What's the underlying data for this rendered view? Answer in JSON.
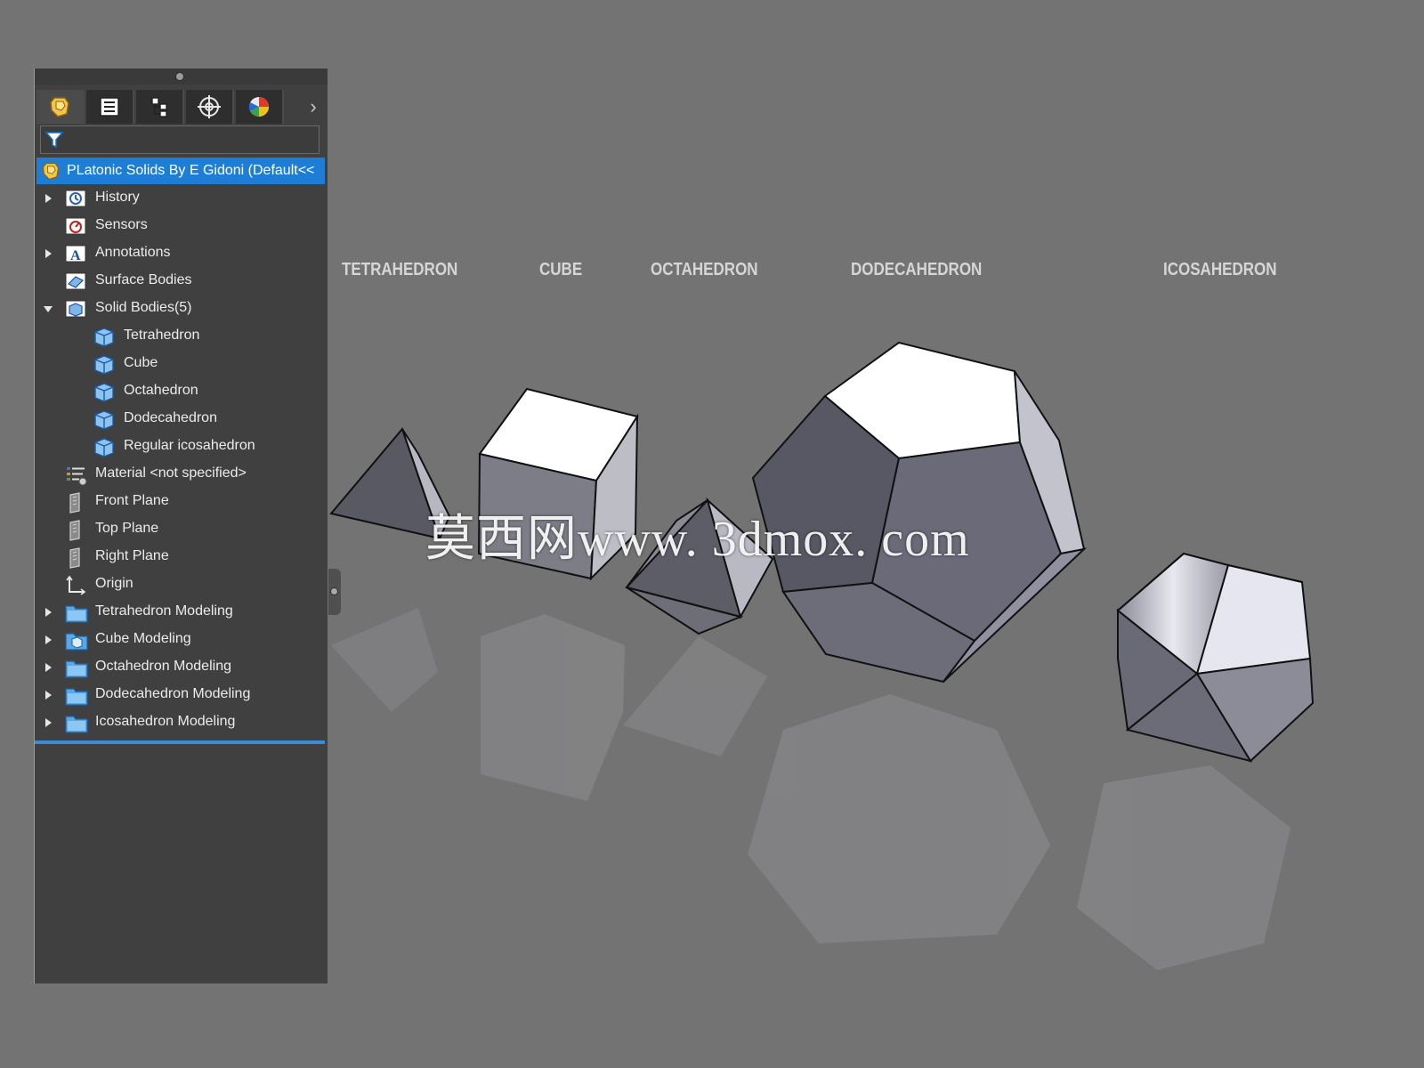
{
  "panel": {
    "tabs": [
      {
        "icon": "part-icon"
      },
      {
        "icon": "property-manager-icon"
      },
      {
        "icon": "configuration-manager-icon"
      },
      {
        "icon": "dimxpert-icon"
      },
      {
        "icon": "display-manager-icon"
      }
    ],
    "filter_icon": "filter-icon",
    "root": {
      "label": "PLatonic Solids By E Gidoni  (Default<<"
    },
    "tree": [
      {
        "label": "History",
        "icon": "history-icon",
        "expander": "collapsed",
        "indent": 0
      },
      {
        "label": "Sensors",
        "icon": "sensors-icon",
        "expander": "none",
        "indent": 0
      },
      {
        "label": "Annotations",
        "icon": "annotations-icon",
        "expander": "collapsed",
        "indent": 0
      },
      {
        "label": "Surface Bodies",
        "icon": "surface-bodies-icon",
        "expander": "none",
        "indent": 0
      },
      {
        "label": "Solid Bodies(5)",
        "icon": "solid-bodies-icon",
        "expander": "expanded",
        "indent": 0
      },
      {
        "label": "Tetrahedron",
        "icon": "solid-body-icon",
        "expander": "none",
        "indent": 1
      },
      {
        "label": "Cube",
        "icon": "solid-body-icon",
        "expander": "none",
        "indent": 1
      },
      {
        "label": "Octahedron",
        "icon": "solid-body-icon",
        "expander": "none",
        "indent": 1
      },
      {
        "label": "Dodecahedron",
        "icon": "solid-body-icon",
        "expander": "none",
        "indent": 1
      },
      {
        "label": "Regular icosahedron",
        "icon": "solid-body-icon",
        "expander": "none",
        "indent": 1
      },
      {
        "label": "Material <not specified>",
        "icon": "material-icon",
        "expander": "none",
        "indent": 0
      },
      {
        "label": "Front Plane",
        "icon": "plane-icon",
        "expander": "none",
        "indent": 0
      },
      {
        "label": "Top Plane",
        "icon": "plane-icon",
        "expander": "none",
        "indent": 0
      },
      {
        "label": "Right Plane",
        "icon": "plane-icon",
        "expander": "none",
        "indent": 0
      },
      {
        "label": "Origin",
        "icon": "origin-icon",
        "expander": "none",
        "indent": 0
      },
      {
        "label": "Tetrahedron Modeling",
        "icon": "folder-icon",
        "expander": "collapsed",
        "indent": 0
      },
      {
        "label": "Cube Modeling",
        "icon": "part-folder-icon",
        "expander": "collapsed",
        "indent": 0
      },
      {
        "label": "Octahedron Modeling",
        "icon": "folder-icon",
        "expander": "collapsed",
        "indent": 0
      },
      {
        "label": "Dodecahedron Modeling",
        "icon": "folder-icon",
        "expander": "collapsed",
        "indent": 0
      },
      {
        "label": "Icosahedron Modeling",
        "icon": "folder-icon",
        "expander": "collapsed",
        "indent": 0
      }
    ]
  },
  "viewport": {
    "titles": {
      "tetrahedron": "TETRAHEDRON",
      "cube": "CUBE",
      "octahedron": "OCTAHEDRON",
      "dodecahedron": "DODECAHEDRON",
      "icosahedron": "ICOSAHEDRON"
    },
    "watermark": "莫西网www. 3dmox. com"
  },
  "colors": {
    "background": "#737373",
    "panel": "#404040",
    "selection": "#1e7ed6",
    "accent_line": "#3a8ad6"
  }
}
